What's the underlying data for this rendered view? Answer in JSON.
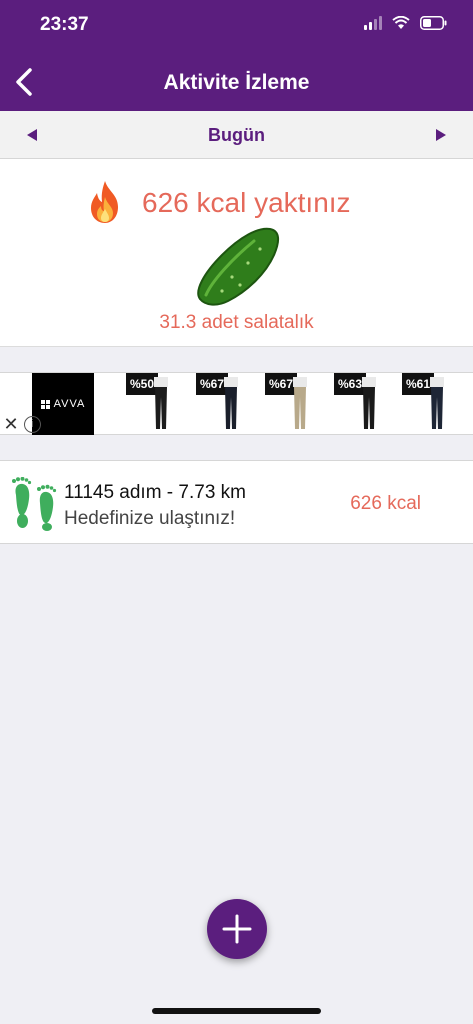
{
  "status_bar": {
    "time": "23:37"
  },
  "header": {
    "title": "Aktivite İzleme"
  },
  "date_nav": {
    "label": "Bugün"
  },
  "summary": {
    "kcal_burned": "626 kcal yaktınız",
    "equivalent": "31.3 adet salatalık"
  },
  "ad": {
    "brand": "AVVA",
    "close_label": "✕",
    "info_label": "i",
    "products": [
      {
        "discount": "%50",
        "pants_color": "#1c1c1c"
      },
      {
        "discount": "%67",
        "pants_color": "#1a1f2b"
      },
      {
        "discount": "%67",
        "pants_color": "#b8a98a"
      },
      {
        "discount": "%63",
        "pants_color": "#1a1a1a"
      },
      {
        "discount": "%61",
        "pants_color": "#1e2636"
      }
    ]
  },
  "activity": {
    "steps": "11145 adım - 7.73 km",
    "goal": "Hedefinize ulaştınız!",
    "kcal": "626 kcal"
  },
  "colors": {
    "primary": "#5b1e7e",
    "accent": "#e5695a",
    "feet": "#3fae5d"
  }
}
